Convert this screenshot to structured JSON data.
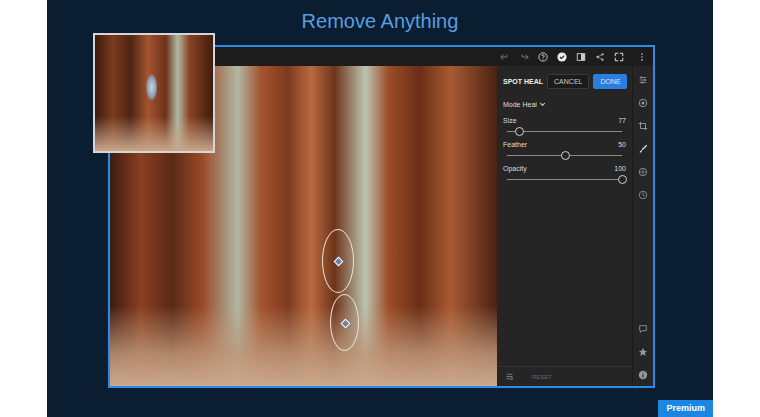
{
  "page": {
    "title": "Remove Anything"
  },
  "badge": "Premium",
  "tool": {
    "title": "SPOT HEAL",
    "buttons": [
      {
        "label": "CANCEL",
        "primary": false
      },
      {
        "label": "DONE",
        "primary": true
      }
    ],
    "mode": "Mode Heal",
    "sliders": [
      {
        "label": "Size",
        "reading": "77",
        "level": 0.1
      },
      {
        "label": "Feather",
        "reading": "50",
        "level": 0.5
      },
      {
        "label": "Opacity",
        "reading": "100",
        "level": 1
      }
    ],
    "reset": {
      "label": "RESET",
      "disabled": true
    }
  }
}
